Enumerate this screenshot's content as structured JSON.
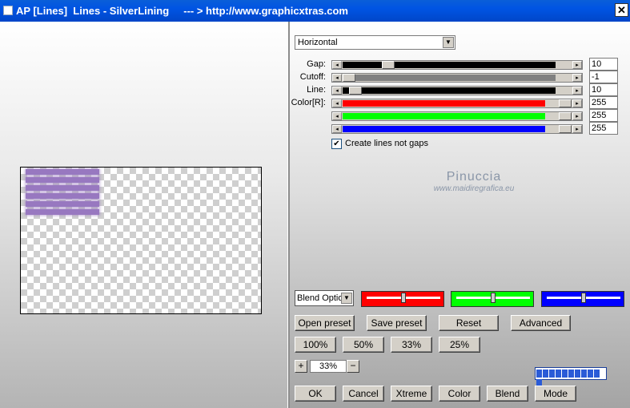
{
  "window": {
    "title": "AP [Lines]  Lines - SilverLining     --- > http://www.graphicxtras.com",
    "close_label": "✕"
  },
  "preview": {
    "line_color": "#9878c0"
  },
  "direction": {
    "value": "Horizontal"
  },
  "params": [
    {
      "label": "Gap:",
      "value": "10",
      "fraction": 0.18,
      "track_color": "#000000"
    },
    {
      "label": "Cutoff:",
      "value": "-1",
      "fraction": 0.0,
      "track_color": "#808080"
    },
    {
      "label": "Line:",
      "value": "10",
      "fraction": 0.03,
      "track_color": "#000000"
    },
    {
      "label": "Color[R]:",
      "value": "255",
      "fraction": 1.0,
      "track_color": "#ff0000"
    },
    {
      "label": "",
      "value": "255",
      "fraction": 1.0,
      "track_color": "#00ff00"
    },
    {
      "label": "",
      "value": "255",
      "fraction": 1.0,
      "track_color": "#0000ff"
    }
  ],
  "checkbox": {
    "label": "Create lines not gaps",
    "checked": true
  },
  "watermark": {
    "line1": "Pinuccia",
    "line2": "www.maidiregrafica.eu"
  },
  "blend": {
    "value": "Blend Optio"
  },
  "color_boxes": [
    {
      "color": "#ff0000",
      "fraction": 0.5
    },
    {
      "color": "#00ff00",
      "fraction": 0.5
    },
    {
      "color": "#0000ff",
      "fraction": 0.5
    }
  ],
  "buttons": {
    "open_preset": "Open preset",
    "save_preset": "Save preset",
    "reset": "Reset",
    "advanced": "Advanced",
    "z100": "100%",
    "z50": "50%",
    "z33": "33%",
    "z25": "25%",
    "ok": "OK",
    "cancel": "Cancel",
    "xtreme": "Xtreme",
    "color": "Color",
    "blend": "Blend",
    "mode": "Mode"
  },
  "zoom": {
    "plus": "+",
    "value": "33%",
    "minus": "−"
  },
  "progress": {
    "cells": 11
  }
}
